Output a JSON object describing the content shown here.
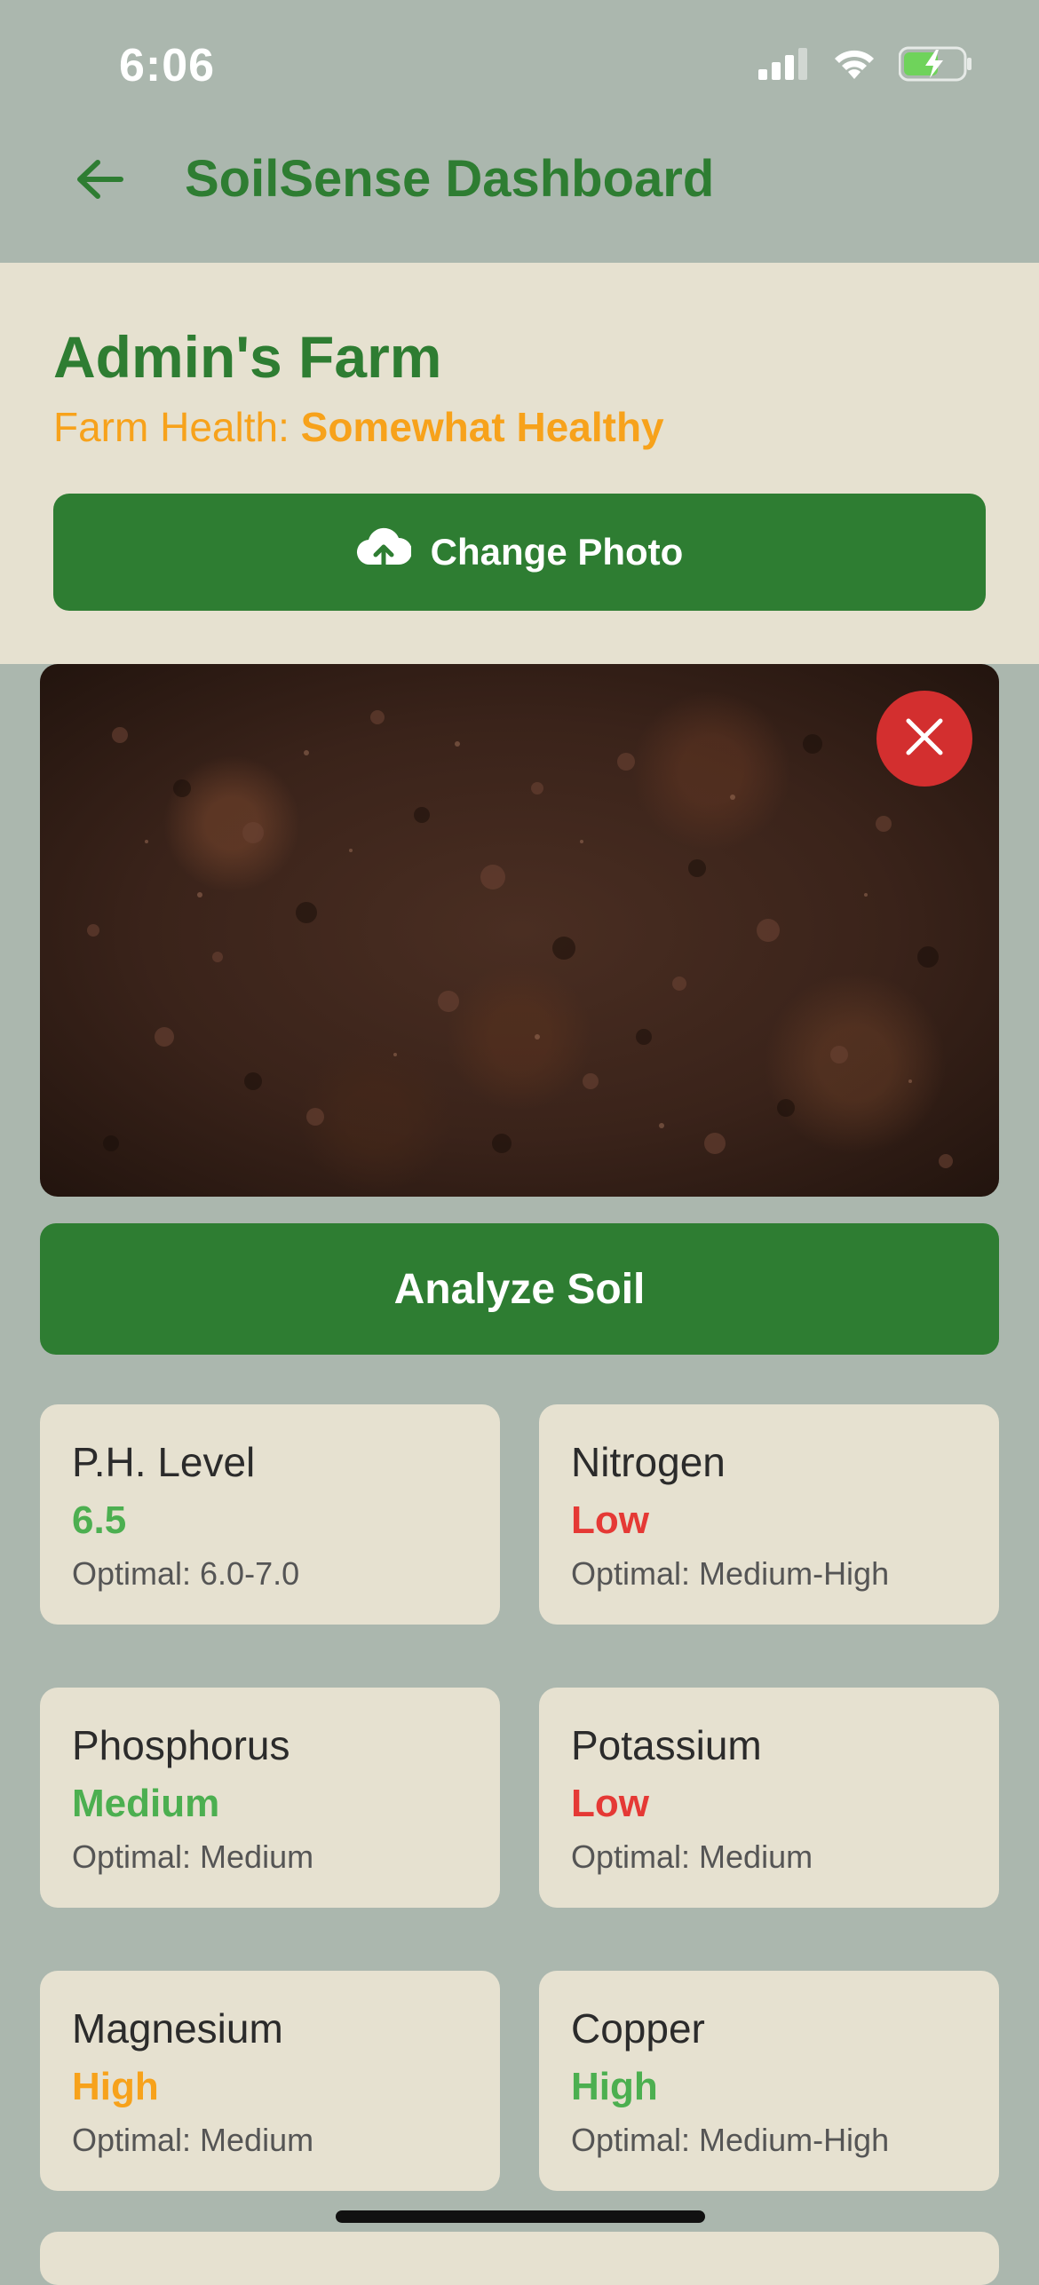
{
  "status_bar": {
    "time": "6:06",
    "icons": [
      "signal-icon",
      "wifi-icon",
      "battery-charging-icon"
    ]
  },
  "header": {
    "title": "SoilSense Dashboard",
    "back_icon": "arrow-left-icon"
  },
  "farm": {
    "name": "Admin's Farm",
    "health_label": "Farm Health:",
    "health_value": "Somewhat Healthy"
  },
  "actions": {
    "change_photo_label": "Change Photo",
    "change_photo_icon": "cloud-upload-icon",
    "remove_photo_icon": "close-icon",
    "analyze_label": "Analyze Soil"
  },
  "colors": {
    "background": "#abb7ae",
    "panel": "#e6e1d0",
    "primary_green": "#2e7d32",
    "good_green": "#4caf50",
    "warning_orange": "#f7a21b",
    "danger_red": "#e53935",
    "close_red": "#d32f2f"
  },
  "metrics": [
    {
      "name": "P.H. Level",
      "value": "6.5",
      "status": "good",
      "optimal": "Optimal: 6.0-7.0"
    },
    {
      "name": "Nitrogen",
      "value": "Low",
      "status": "bad",
      "optimal": "Optimal: Medium-High"
    },
    {
      "name": "Phosphorus",
      "value": "Medium",
      "status": "good",
      "optimal": "Optimal: Medium"
    },
    {
      "name": "Potassium",
      "value": "Low",
      "status": "bad",
      "optimal": "Optimal: Medium"
    },
    {
      "name": "Magnesium",
      "value": "High",
      "status": "warning",
      "optimal": "Optimal: Medium"
    },
    {
      "name": "Copper",
      "value": "High",
      "status": "good",
      "optimal": "Optimal: Medium-High"
    }
  ]
}
